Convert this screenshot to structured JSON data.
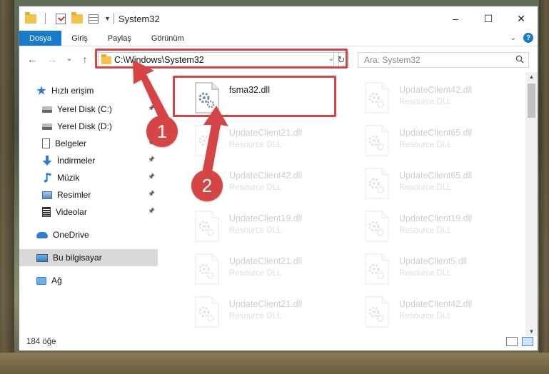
{
  "window": {
    "title": "System32",
    "controls": [
      "–",
      "☐",
      "✕"
    ]
  },
  "ribbon": {
    "tabs": [
      "Dosya",
      "Giriş",
      "Paylaş",
      "Görünüm"
    ],
    "active_tab": "Dosya",
    "help_label": "?"
  },
  "nav": {
    "back": "←",
    "forward": "→",
    "recent": "⌄",
    "up": "↑",
    "path": "C:\\Windows\\System32",
    "refresh": "↻",
    "search_placeholder": "Ara: System32"
  },
  "sidebar": {
    "items": [
      {
        "label": "Hızlı erişim",
        "icon": "star-icon"
      },
      {
        "label": "Yerel Disk (C:)",
        "icon": "drive-icon",
        "pinned": true
      },
      {
        "label": "Yerel Disk (D:)",
        "icon": "drive-icon",
        "pinned": true
      },
      {
        "label": "Belgeler",
        "icon": "documents-icon",
        "pinned": true
      },
      {
        "label": "İndirmeler",
        "icon": "download-icon",
        "pinned": true
      },
      {
        "label": "Müzik",
        "icon": "music-icon",
        "pinned": true
      },
      {
        "label": "Resimler",
        "icon": "pictures-icon",
        "pinned": true
      },
      {
        "label": "Videolar",
        "icon": "video-icon",
        "pinned": true
      },
      {
        "label": "OneDrive",
        "icon": "cloud-icon"
      },
      {
        "label": "Bu bilgisayar",
        "icon": "computer-icon",
        "selected": true
      },
      {
        "label": "Ağ",
        "icon": "network-icon"
      }
    ]
  },
  "files": [
    {
      "name": "fsma32.dll",
      "type": "",
      "highlighted": true
    },
    {
      "name": "UpdateClient42.dll",
      "type": "Resource DLL"
    },
    {
      "name": "UpdateClient21.dll",
      "type": "Resource DLL"
    },
    {
      "name": "UpdateClient65.dll",
      "type": "Resource DLL"
    },
    {
      "name": "UpdateClient42.dll",
      "type": "Resource DLL"
    },
    {
      "name": "UpdateClient65.dll",
      "type": "Resource DLL"
    },
    {
      "name": "UpdateClient19.dll",
      "type": "Resource DLL"
    },
    {
      "name": "UpdateClient19.dll",
      "type": "Resource DLL"
    },
    {
      "name": "UpdateClient21.dll",
      "type": "Resource DLL"
    },
    {
      "name": "UpdateClient5.dll",
      "type": "Resource DLL"
    },
    {
      "name": "UpdateClient21.dll",
      "type": "Resource DLL"
    },
    {
      "name": "UpdateClient42.dll",
      "type": "Resource DLL"
    }
  ],
  "status": {
    "count": "184 öğe"
  },
  "callouts": {
    "one": "1",
    "two": "2"
  },
  "colors": {
    "accent": "#1979ca",
    "callout": "#d64545"
  }
}
